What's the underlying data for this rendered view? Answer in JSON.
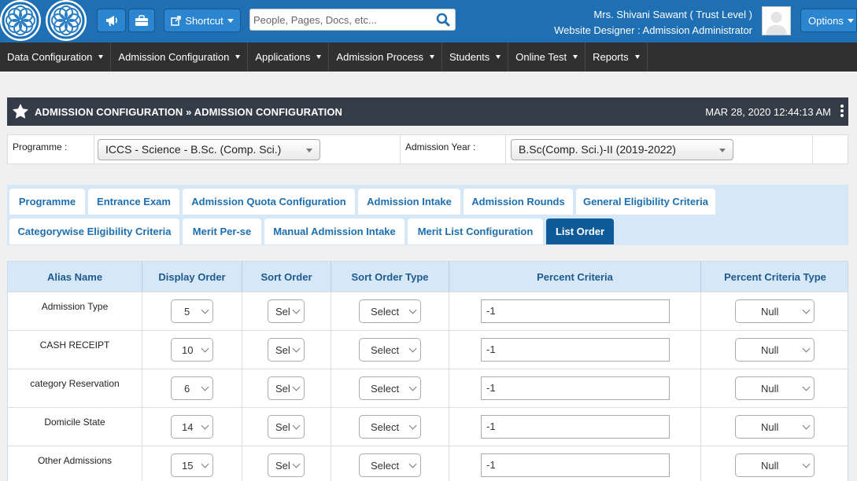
{
  "header": {
    "shortcut_label": "Shortcut",
    "search_placeholder": "People, Pages, Docs, etc...",
    "user_name_line": "Mrs. Shivani Sawant ( Trust Level )",
    "user_role_line": "Website Designer : Admission Administrator",
    "options_label": "Options"
  },
  "nav": {
    "items": [
      {
        "label": "Data Configuration"
      },
      {
        "label": "Admission Configuration"
      },
      {
        "label": "Applications"
      },
      {
        "label": "Admission Process"
      },
      {
        "label": "Students"
      },
      {
        "label": "Online Test"
      },
      {
        "label": "Reports"
      }
    ]
  },
  "titlebar": {
    "title": "ADMISSION CONFIGURATION » ADMISSION CONFIGURATION",
    "datetime": "MAR 28, 2020   12:44:13 AM"
  },
  "filters": {
    "programme_label": "Programme :",
    "programme_value": "ICCS - Science - B.Sc. (Comp. Sci.)",
    "year_label": "Admission Year :",
    "year_value": "B.Sc(Comp. Sci.)-II (2019-2022)"
  },
  "tabs": {
    "row1": [
      {
        "label": "Programme"
      },
      {
        "label": "Entrance Exam"
      },
      {
        "label": "Admission Quota Configuration"
      },
      {
        "label": "Admission Intake"
      },
      {
        "label": "Admission Rounds"
      },
      {
        "label": "General Eligibility Criteria"
      }
    ],
    "row2": [
      {
        "label": "Categorywise Eligibility Criteria"
      },
      {
        "label": "Merit Per-se"
      },
      {
        "label": "Manual Admission Intake"
      },
      {
        "label": "Merit List Configuration"
      },
      {
        "label": "List Order"
      }
    ],
    "active": "List Order"
  },
  "table": {
    "headers": {
      "alias": "Alias Name",
      "display_order": "Display Order",
      "sort_order": "Sort Order",
      "sort_order_type": "Sort Order Type",
      "percent_criteria": "Percent Criteria",
      "percent_criteria_type": "Percent Criteria Type"
    },
    "rows": [
      {
        "alias": "Admission Type",
        "display_order": "5",
        "sort_order": "Sel",
        "sort_order_type": "Select",
        "percent_criteria": "-1",
        "percent_criteria_type": "Null"
      },
      {
        "alias": "CASH RECEIPT",
        "display_order": "10",
        "sort_order": "Sel",
        "sort_order_type": "Select",
        "percent_criteria": "-1",
        "percent_criteria_type": "Null"
      },
      {
        "alias": "category Reservation",
        "display_order": "6",
        "sort_order": "Sel",
        "sort_order_type": "Select",
        "percent_criteria": "-1",
        "percent_criteria_type": "Null"
      },
      {
        "alias": "Domicile State",
        "display_order": "14",
        "sort_order": "Sel",
        "sort_order_type": "Select",
        "percent_criteria": "-1",
        "percent_criteria_type": "Null"
      },
      {
        "alias": "Other Admissions",
        "display_order": "15",
        "sort_order": "Sel",
        "sort_order_type": "Select",
        "percent_criteria": "-1",
        "percent_criteria_type": "Null"
      }
    ]
  },
  "colors": {
    "header_blue": "#1e6fb3",
    "nav_dark": "#303030",
    "title_dark": "#333c47",
    "tab_text": "#1d6fb0",
    "tab_active": "#0f5a99",
    "table_head": "#d6e7f7"
  }
}
